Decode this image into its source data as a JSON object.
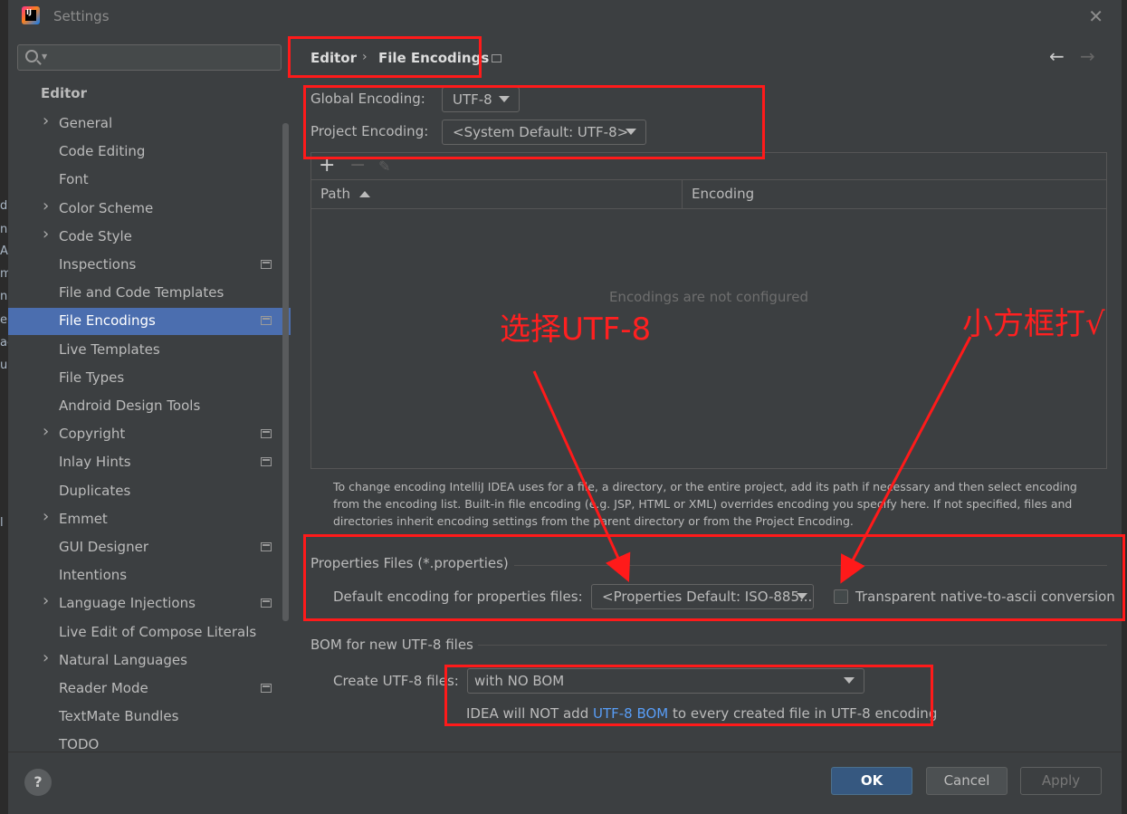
{
  "window": {
    "title": "Settings"
  },
  "left_strip": [
    "d",
    "n",
    "A",
    "m",
    "n",
    "e",
    "ac",
    "u",
    "l"
  ],
  "sidebar": {
    "search_placeholder": "",
    "section": "Editor",
    "items": [
      {
        "label": "General",
        "expandable": true,
        "badge": false,
        "selected": false
      },
      {
        "label": "Code Editing",
        "expandable": false,
        "badge": false,
        "selected": false
      },
      {
        "label": "Font",
        "expandable": false,
        "badge": false,
        "selected": false
      },
      {
        "label": "Color Scheme",
        "expandable": true,
        "badge": false,
        "selected": false
      },
      {
        "label": "Code Style",
        "expandable": true,
        "badge": false,
        "selected": false
      },
      {
        "label": "Inspections",
        "expandable": false,
        "badge": true,
        "selected": false
      },
      {
        "label": "File and Code Templates",
        "expandable": false,
        "badge": false,
        "selected": false
      },
      {
        "label": "File Encodings",
        "expandable": false,
        "badge": true,
        "selected": true
      },
      {
        "label": "Live Templates",
        "expandable": false,
        "badge": false,
        "selected": false
      },
      {
        "label": "File Types",
        "expandable": false,
        "badge": false,
        "selected": false
      },
      {
        "label": "Android Design Tools",
        "expandable": false,
        "badge": false,
        "selected": false
      },
      {
        "label": "Copyright",
        "expandable": true,
        "badge": true,
        "selected": false
      },
      {
        "label": "Inlay Hints",
        "expandable": false,
        "badge": true,
        "selected": false
      },
      {
        "label": "Duplicates",
        "expandable": false,
        "badge": false,
        "selected": false
      },
      {
        "label": "Emmet",
        "expandable": true,
        "badge": false,
        "selected": false
      },
      {
        "label": "GUI Designer",
        "expandable": false,
        "badge": true,
        "selected": false
      },
      {
        "label": "Intentions",
        "expandable": false,
        "badge": false,
        "selected": false
      },
      {
        "label": "Language Injections",
        "expandable": true,
        "badge": true,
        "selected": false
      },
      {
        "label": "Live Edit of Compose Literals",
        "expandable": false,
        "badge": false,
        "selected": false
      },
      {
        "label": "Natural Languages",
        "expandable": true,
        "badge": false,
        "selected": false
      },
      {
        "label": "Reader Mode",
        "expandable": false,
        "badge": true,
        "selected": false
      },
      {
        "label": "TextMate Bundles",
        "expandable": false,
        "badge": false,
        "selected": false
      },
      {
        "label": "TODO",
        "expandable": false,
        "badge": false,
        "selected": false
      }
    ]
  },
  "breadcrumb": {
    "parent": "Editor",
    "separator": "›",
    "current": "File Encodings"
  },
  "nav": {
    "back": "←",
    "forward": "→"
  },
  "global_encoding": {
    "label": "Global Encoding:",
    "value": "UTF-8"
  },
  "project_encoding": {
    "label": "Project Encoding:",
    "value": "<System Default: UTF-8>"
  },
  "table": {
    "toolbar": {
      "add": "+",
      "remove": "−",
      "edit": "✎"
    },
    "columns": [
      "Path",
      "Encoding"
    ],
    "empty_text": "Encodings are not configured"
  },
  "help_text": "To change encoding IntelliJ IDEA uses for a file, a directory, or the entire project, add its path if necessary and then select encoding from the encoding list. Built-in file encoding (e.g. JSP, HTML or XML) overrides encoding you specify here. If not specified, files and directories inherit encoding settings from the parent directory or from the Project Encoding.",
  "properties": {
    "title": "Properties Files (*.properties)",
    "default_label": "Default encoding for properties files:",
    "default_value": "<Properties Default: ISO-885...",
    "transparent_label": "Transparent native-to-ascii conversion",
    "transparent_checked": false
  },
  "bom": {
    "title": "BOM for new UTF-8 files",
    "create_label": "Create UTF-8 files:",
    "create_value": "with NO BOM",
    "note_prefix": "IDEA will NOT add ",
    "note_link": "UTF-8 BOM",
    "note_suffix": " to every created file in UTF-8 encoding"
  },
  "buttons": {
    "help": "?",
    "ok": "OK",
    "cancel": "Cancel",
    "apply": "Apply"
  },
  "annotations": {
    "select_utf8": "选择UTF-8",
    "tick_box": "小方框打√"
  },
  "colors": {
    "accent_red": "#ff1a1a",
    "selection": "#4b6eaf",
    "link": "#589df6",
    "ok_button": "#365880"
  }
}
